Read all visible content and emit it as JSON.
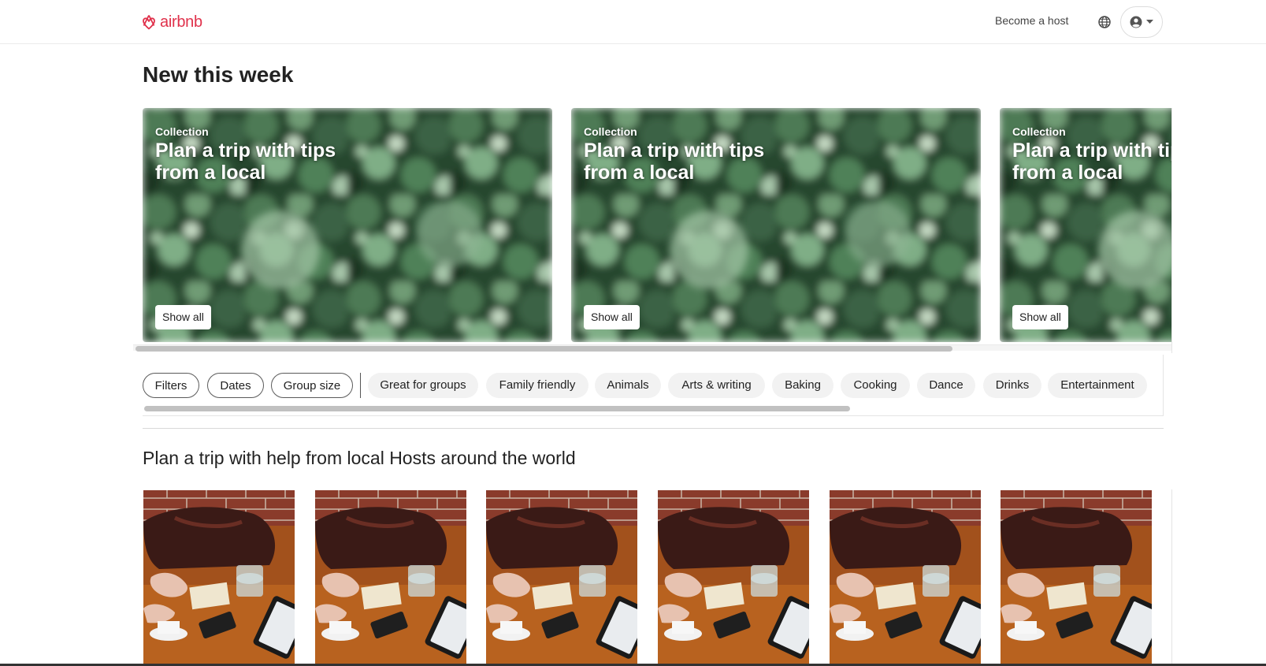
{
  "header": {
    "brand": "airbnb",
    "become_host": "Become a host",
    "icons": [
      "airbnb-logo-icon",
      "globe-icon",
      "user-circle-icon",
      "caret-down-icon"
    ],
    "brand_color": "#e0314b"
  },
  "new_this_week": {
    "title": "New this week",
    "cards": [
      {
        "kicker": "Collection",
        "headline": "Plan a trip with tips from a local",
        "button": "Show all"
      },
      {
        "kicker": "Collection",
        "headline": "Plan a trip with tips from a local",
        "button": "Show all"
      },
      {
        "kicker": "Collection",
        "headline": "Plan a trip with tips from a local",
        "button": "Show all"
      }
    ]
  },
  "filters": {
    "outline_pills": [
      "Filters",
      "Dates",
      "Group size"
    ],
    "category_pills": [
      "Great for groups",
      "Family friendly",
      "Animals",
      "Arts & writing",
      "Baking",
      "Cooking",
      "Dance",
      "Drinks",
      "Entertainment"
    ]
  },
  "plan_trip": {
    "title": "Plan a trip with help from local Hosts around the world",
    "card_count": 6
  }
}
